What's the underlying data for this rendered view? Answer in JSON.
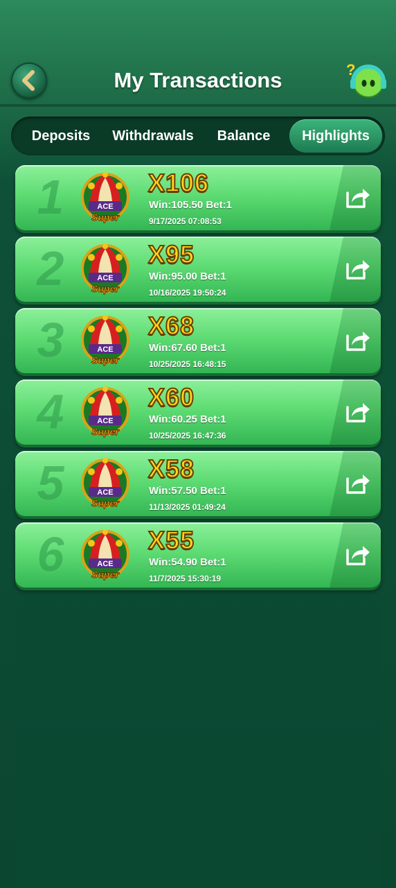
{
  "header": {
    "title": "My Transactions"
  },
  "tabs": [
    {
      "label": "Deposits"
    },
    {
      "label": "Withdrawals"
    },
    {
      "label": "Balance"
    },
    {
      "label": "Highlights"
    }
  ],
  "active_tab": "Highlights",
  "highlights": [
    {
      "rank": "1",
      "game": "Super Ace",
      "multiplier": "X106",
      "win_bet": "Win:105.50 Bet:1",
      "time": "9/17/2025 07:08:53"
    },
    {
      "rank": "2",
      "game": "Super Ace",
      "multiplier": "X95",
      "win_bet": "Win:95.00 Bet:1",
      "time": "10/16/2025 19:50:24"
    },
    {
      "rank": "3",
      "game": "Super Ace",
      "multiplier": "X68",
      "win_bet": "Win:67.60 Bet:1",
      "time": "10/25/2025 16:48:15"
    },
    {
      "rank": "4",
      "game": "Super Ace",
      "multiplier": "X60",
      "win_bet": "Win:60.25 Bet:1",
      "time": "10/25/2025 16:47:36"
    },
    {
      "rank": "5",
      "game": "Super Ace",
      "multiplier": "X58",
      "win_bet": "Win:57.50 Bet:1",
      "time": "11/13/2025 01:49:24"
    },
    {
      "rank": "6",
      "game": "Super Ace",
      "multiplier": "X55",
      "win_bet": "Win:54.90 Bet:1",
      "time": "11/7/2025 15:30:19"
    }
  ],
  "icons": {
    "back": "chevron-left-icon",
    "support": "support-bot-icon",
    "share": "share-icon",
    "game": "super-ace-icon"
  },
  "colors": {
    "accent_gold": "#ffd51e",
    "card_green": "#5fdc74",
    "background": "#0b4630"
  }
}
